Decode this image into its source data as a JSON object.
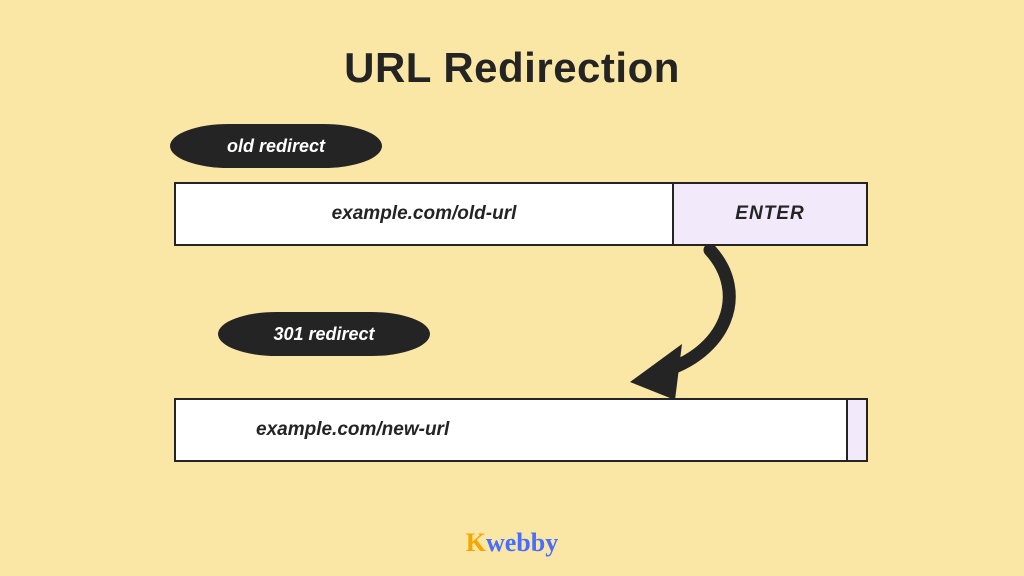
{
  "title": "URL Redirection",
  "pill_old": "old redirect",
  "pill_new": "301 redirect",
  "url_old": "example.com/old-url",
  "enter_label": "ENTER",
  "url_new": "example.com/new-url",
  "logo_k": "K",
  "logo_rest": "webby"
}
